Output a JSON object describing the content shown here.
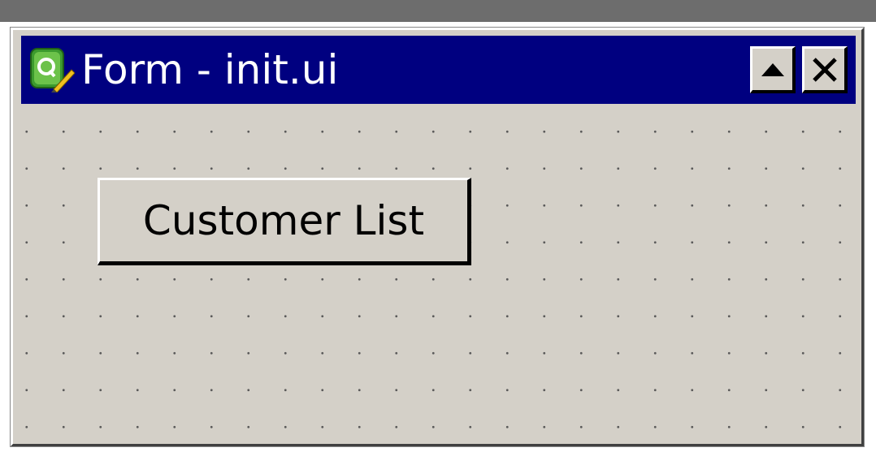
{
  "window": {
    "title": "Form - init.ui",
    "titlebar_color": "#000080",
    "background_color": "#d4d0c8"
  },
  "icons": {
    "app": "qt-designer-icon",
    "shade": "triangle-up-icon",
    "close": "close-x-icon"
  },
  "form": {
    "button_label": "Customer List"
  }
}
